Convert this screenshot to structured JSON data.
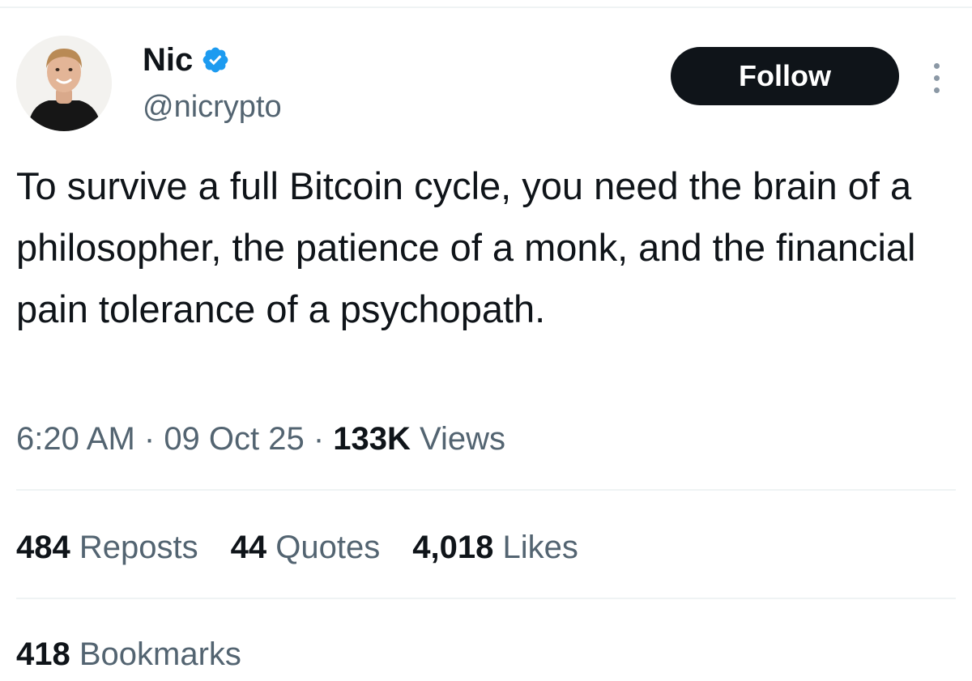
{
  "user": {
    "display_name": "Nic",
    "handle": "@nicrypto",
    "verified_icon": "verified-badge-icon",
    "verified_color": "#1d9bf0"
  },
  "actions": {
    "follow_label": "Follow",
    "more_icon": "more-vertical-icon"
  },
  "tweet": {
    "text": "To survive a full Bitcoin cycle, you need the brain of a philosopher, the patience of a monk, and the financial pain tolerance of a psychopath."
  },
  "meta": {
    "time": "6:20 AM",
    "separator": " · ",
    "date": "09 Oct 25",
    "views_count": "133K",
    "views_label": "Views"
  },
  "stats": {
    "reposts_count": "484",
    "reposts_label": "Reposts",
    "quotes_count": "44",
    "quotes_label": "Quotes",
    "likes_count": "4,018",
    "likes_label": "Likes",
    "bookmarks_count": "418",
    "bookmarks_label": "Bookmarks"
  },
  "colors": {
    "text_primary": "#0f1419",
    "text_secondary": "#536471",
    "button_bg": "#0f1419",
    "divider": "#eff3f4"
  }
}
